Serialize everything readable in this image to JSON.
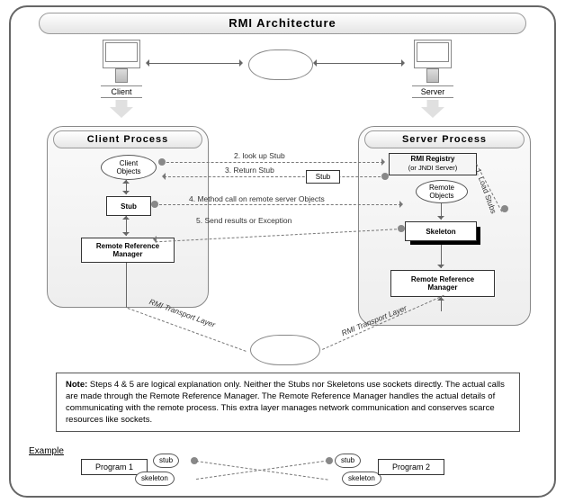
{
  "title": "RMI Architecture",
  "hosts": {
    "client": "Client",
    "server": "Server"
  },
  "process": {
    "client": "Client Process",
    "server": "Server Process"
  },
  "components": {
    "clientObjects": "Client\nObjects",
    "clientStub": "Stub",
    "clientRRM": "Remote Reference\nManager",
    "rmiRegistry1": "RMI Registry",
    "rmiRegistry2": "(or JNDI  Server)",
    "remoteObjects": "Remote\nObjects",
    "skeleton": "Skeleton",
    "serverRRM": "Remote Reference\nManager",
    "stubMsg": "Stub"
  },
  "msgs": {
    "m1": "1. Load Stubs",
    "m2": "2. look up Stub",
    "m3": "3. Return Stub",
    "m4": "4. Method call on remote server Objects",
    "m5": "5. Send results or Exception",
    "t1": "RMI Transport Layer",
    "t2": "RMI Transport Layer"
  },
  "note": "Steps 4 & 5  are  logical explanation only. Neither the Stubs nor Skeletons use sockets directly. The actual calls are made  through the Remote Reference Manager.  The  Remote Reference Manager handles the actual details of communicating with the remote process. This extra layer manages network communication and conserves scarce resources like sockets.",
  "noteLabel": "Note:",
  "example": {
    "label": "Example",
    "p1": "Program 1",
    "p2": "Program 2",
    "stub": "stub",
    "skeleton": "skeleton"
  }
}
